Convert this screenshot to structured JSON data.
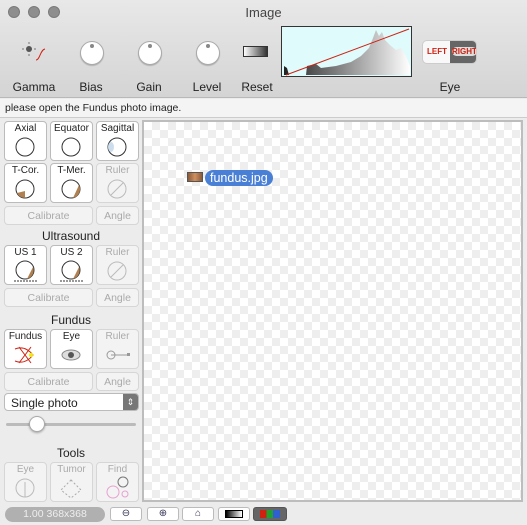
{
  "window": {
    "title": "Image"
  },
  "toolbar": {
    "gamma": "Gamma",
    "bias": "Bias",
    "gain": "Gain",
    "level": "Level",
    "reset": "Reset",
    "eye": "Eye",
    "eye_left": "LEFT",
    "eye_right": "RIGHT",
    "selected_eye": "RIGHT"
  },
  "status": "please open the Fundus photo image.",
  "sidebar": {
    "row1": [
      "Axial",
      "Equator",
      "Sagittal"
    ],
    "row2": [
      "T-Cor.",
      "T-Mer.",
      "Ruler"
    ],
    "calibrate": "Calibrate",
    "angle": "Angle",
    "ultrasound": {
      "header": "Ultrasound",
      "buttons": [
        "US 1",
        "US 2",
        "Ruler"
      ]
    },
    "fundus": {
      "header": "Fundus",
      "buttons": [
        "Fundus",
        "Eye",
        "Ruler"
      ]
    },
    "mode_select": "Single photo",
    "slider_value": 0.24,
    "tools": {
      "header": "Tools",
      "buttons": [
        "Eye",
        "Tumor",
        "Find"
      ]
    }
  },
  "canvas": {
    "file": "fundus.jpg"
  },
  "bottom": {
    "zoom_info": "1.00 368x368"
  },
  "colors": {
    "accent": "#4a7fd6",
    "histogram_bg": "#dffbfc",
    "curve": "#d02010"
  }
}
